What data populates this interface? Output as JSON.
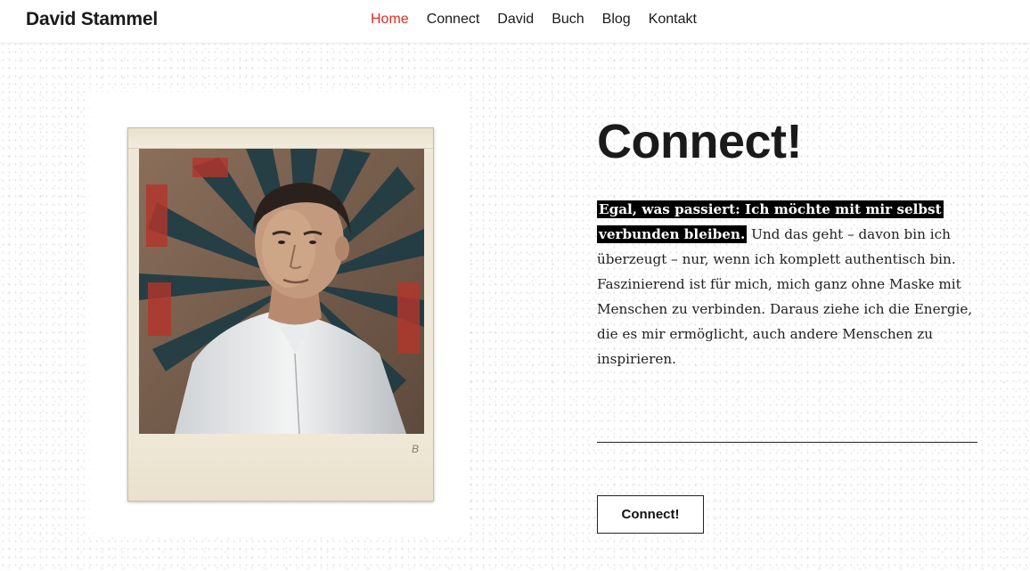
{
  "header": {
    "brand": "David Stammel",
    "nav": [
      {
        "label": "Home",
        "active": true
      },
      {
        "label": "Connect",
        "active": false
      },
      {
        "label": "David",
        "active": false
      },
      {
        "label": "Buch",
        "active": false
      },
      {
        "label": "Blog",
        "active": false
      },
      {
        "label": "Kontakt",
        "active": false
      }
    ]
  },
  "main": {
    "heading": "Connect!",
    "intro_highlight": "Egal, was passiert: Ich möchte mit mir selbst verbunden bleiben.",
    "intro_body": " Und das geht – davon bin ich überzeugt – nur, wenn ich komplett authentisch bin. Faszinierend ist für mich, mich ganz ohne Maske mit Menschen zu verbinden. Daraus ziehe ich die Energie, die es mir ermöglicht, auch andere Menschen zu inspirieren.",
    "cta_label": "Connect!"
  },
  "photo": {
    "polaroid_mark": "B"
  },
  "colors": {
    "accent": "#e8291c",
    "text": "#1a1a1a",
    "highlight_bg": "#000000"
  }
}
